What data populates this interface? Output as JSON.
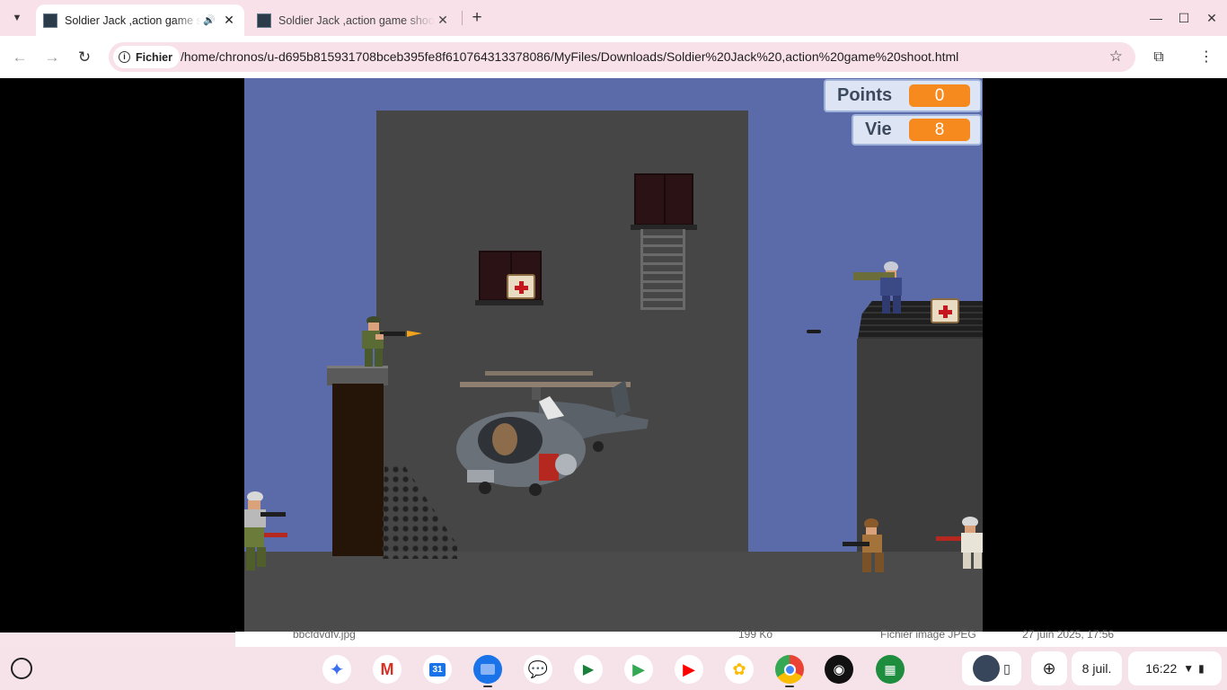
{
  "browser": {
    "tabs": [
      {
        "title": "Soldier Jack ,action game shoot",
        "audio": "speaker-icon"
      },
      {
        "title": "Soldier Jack ,action game shoot"
      }
    ],
    "security_chip": "Fichier",
    "url": "/home/chronos/u-d695b815931708bceb395fe8f610764313378086/MyFiles/Downloads/Soldier%20Jack%20,action%20game%20shoot.html"
  },
  "game": {
    "hud": {
      "points_label": "Points",
      "points_value": "0",
      "life_label": "Vie",
      "life_value": "8"
    },
    "colors": {
      "sky": "#5b6aa9",
      "hud_value": "#f68a1e",
      "building": "#464646"
    }
  },
  "files_peek": {
    "name": "bbcfdvdfv.jpg",
    "size": "199 Ko",
    "type": "Fichier image JPEG",
    "date": "27 juin 2025, 17:56"
  },
  "shelf": {
    "apps": [
      "gemini-icon",
      "gmail-icon",
      "calendar-icon",
      "files-icon",
      "messages-icon",
      "meet-icon",
      "play-store-icon",
      "youtube-icon",
      "photos-icon",
      "chrome-icon",
      "podcast-icon",
      "app-grid-icon"
    ],
    "calendar_day": "31",
    "date": "8 juil.",
    "time": "16:22"
  }
}
